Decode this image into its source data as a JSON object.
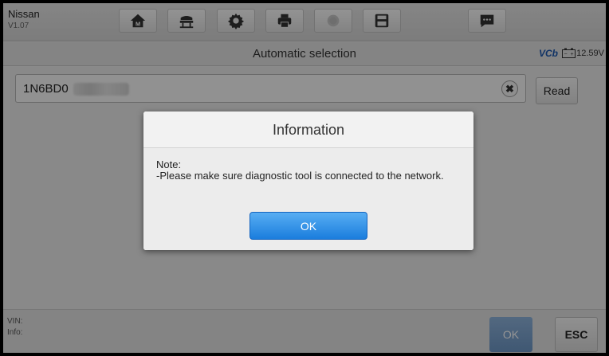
{
  "toolbar": {
    "brand": "Nissan",
    "version": "V1.07",
    "buttons": [
      {
        "icon": "home-icon"
      },
      {
        "icon": "vehicle-lift-icon"
      },
      {
        "icon": "gear-icon"
      },
      {
        "icon": "printer-icon"
      },
      {
        "icon": "help-icon"
      },
      {
        "icon": "save-icon"
      },
      {
        "icon": "message-icon"
      }
    ]
  },
  "titlebar": {
    "title": "Automatic selection",
    "vci_label": "VCb",
    "voltage": "12.59V"
  },
  "vin_input": {
    "value": "1N6BD0"
  },
  "read_label": "Read",
  "bottom": {
    "vin_label": "VIN:",
    "info_label": "Info:",
    "ok_label": "OK",
    "esc_label": "ESC"
  },
  "dialog": {
    "title": "Information",
    "note": "Note:",
    "message": "-Please make sure diagnostic tool is connected to the network.",
    "ok_label": "OK"
  },
  "colors": {
    "accent": "#2a8be6",
    "vci_text": "#1d58b0",
    "overlay": "rgba(0,0,0,0.42)"
  }
}
